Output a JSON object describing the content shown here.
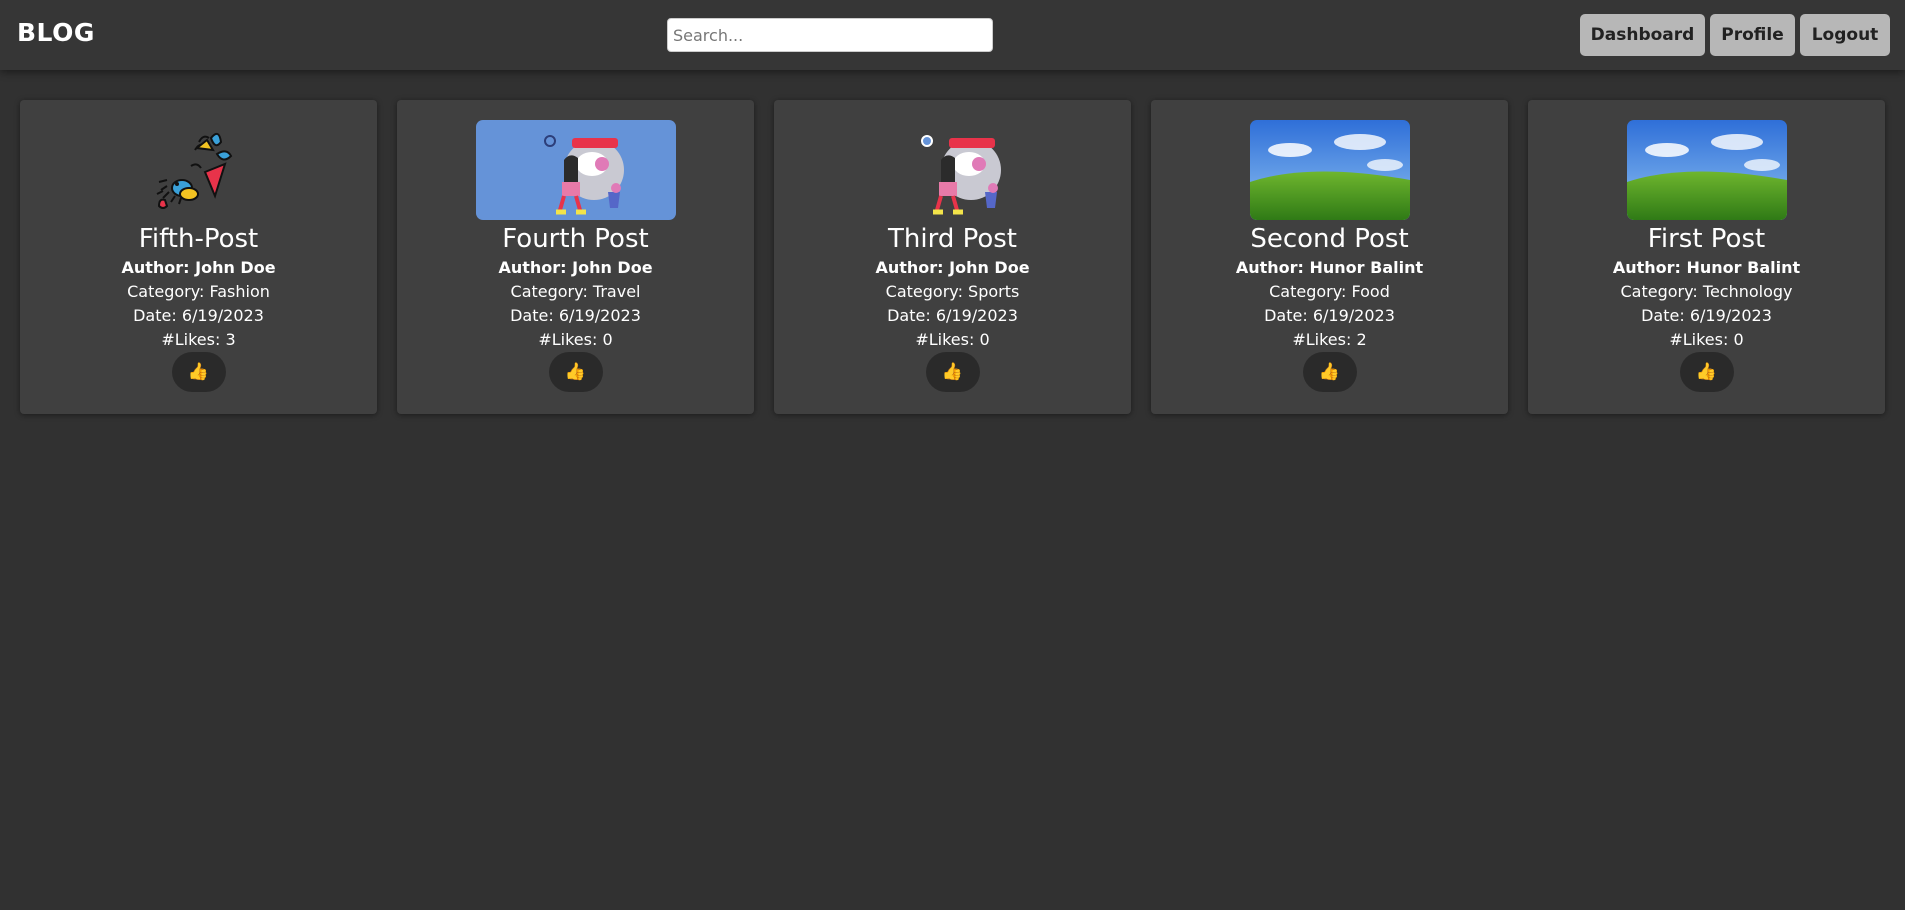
{
  "header": {
    "brand": "BLOG",
    "search_placeholder": "Search...",
    "dashboard_label": "Dashboard",
    "profile_label": "Profile",
    "logout_label": "Logout"
  },
  "posts": [
    {
      "title": "Fifth-Post",
      "author": "Author: John Doe",
      "category": "Category: Fashion",
      "date": "Date: 6/19/2023",
      "likes": "#Likes: 3",
      "like_label": "👍",
      "image": "abstract-bird-illustration"
    },
    {
      "title": "Fourth Post",
      "author": "Author: John Doe",
      "category": "Category: Travel",
      "date": "Date: 6/19/2023",
      "likes": "#Likes: 0",
      "like_label": "👍",
      "image": "character-illustration-blue-bg"
    },
    {
      "title": "Third Post",
      "author": "Author: John Doe",
      "category": "Category: Sports",
      "date": "Date: 6/19/2023",
      "likes": "#Likes: 0",
      "like_label": "👍",
      "image": "character-illustration"
    },
    {
      "title": "Second Post",
      "author": "Author: Hunor Balint",
      "category": "Category: Food",
      "date": "Date: 6/19/2023",
      "likes": "#Likes: 2",
      "like_label": "👍",
      "image": "green-hill-landscape"
    },
    {
      "title": "First Post",
      "author": "Author: Hunor Balint",
      "category": "Category: Technology",
      "date": "Date: 6/19/2023",
      "likes": "#Likes: 0",
      "like_label": "👍",
      "image": "green-hill-landscape"
    }
  ],
  "colors": {
    "background": "#313131",
    "navbar": "#363636",
    "card": "#404040",
    "nav_button": "#b7b7b7",
    "like_button": "#2a2a2a"
  }
}
